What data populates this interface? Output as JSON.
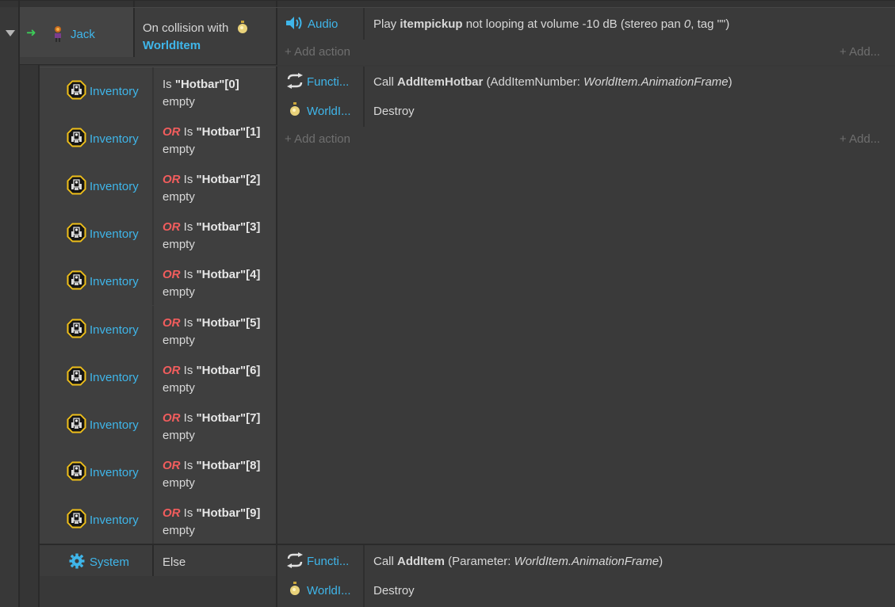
{
  "event": {
    "object": "Jack",
    "condition_text": "On collision with",
    "condition_target": "WorldItem",
    "actions": [
      {
        "object": "Audio",
        "pre": "Play ",
        "bold": "itempickup",
        "post": " not looping at volume -10 dB (stereo pan ",
        "ital": "0",
        "post2": ", tag \"\")"
      }
    ],
    "add_action": "Add action",
    "add_short": "Add..."
  },
  "sub_event": {
    "conditions": [
      {
        "object": "Inventory",
        "or": "",
        "is": "Is ",
        "hotbar": "\"Hotbar\"[0]",
        "empty": "empty"
      },
      {
        "object": "Inventory",
        "or": "OR",
        "is": " Is ",
        "hotbar": "\"Hotbar\"[1]",
        "empty": "empty"
      },
      {
        "object": "Inventory",
        "or": "OR",
        "is": " Is ",
        "hotbar": "\"Hotbar\"[2]",
        "empty": "empty"
      },
      {
        "object": "Inventory",
        "or": "OR",
        "is": " Is ",
        "hotbar": "\"Hotbar\"[3]",
        "empty": "empty"
      },
      {
        "object": "Inventory",
        "or": "OR",
        "is": " Is ",
        "hotbar": "\"Hotbar\"[4]",
        "empty": "empty"
      },
      {
        "object": "Inventory",
        "or": "OR",
        "is": " Is ",
        "hotbar": "\"Hotbar\"[5]",
        "empty": "empty"
      },
      {
        "object": "Inventory",
        "or": "OR",
        "is": " Is ",
        "hotbar": "\"Hotbar\"[6]",
        "empty": "empty"
      },
      {
        "object": "Inventory",
        "or": "OR",
        "is": " Is ",
        "hotbar": "\"Hotbar\"[7]",
        "empty": "empty"
      },
      {
        "object": "Inventory",
        "or": "OR",
        "is": " Is ",
        "hotbar": "\"Hotbar\"[8]",
        "empty": "empty"
      },
      {
        "object": "Inventory",
        "or": "OR",
        "is": " Is ",
        "hotbar": "\"Hotbar\"[9]",
        "empty": "empty"
      }
    ],
    "actions": [
      {
        "object": "Functi...",
        "pre": "Call ",
        "bold": "AddItemHotbar",
        "post": " (AddItemNumber: ",
        "ital": "WorldItem.AnimationFrame",
        "post2": ")"
      },
      {
        "object": "WorldI...",
        "text": "Destroy"
      }
    ],
    "add_action": "Add action",
    "add_short": "Add..."
  },
  "else_event": {
    "object": "System",
    "condition": "Else",
    "actions": [
      {
        "object": "Functi...",
        "pre": "Call ",
        "bold": "AddItem",
        "post": " (Parameter: ",
        "ital": "WorldItem.AnimationFrame",
        "post2": ")"
      },
      {
        "object": "WorldI...",
        "text": "Destroy"
      }
    ]
  },
  "colors": {
    "object_link": "#3fb6ea",
    "or_keyword": "#f25d5d",
    "background": "#383838"
  }
}
